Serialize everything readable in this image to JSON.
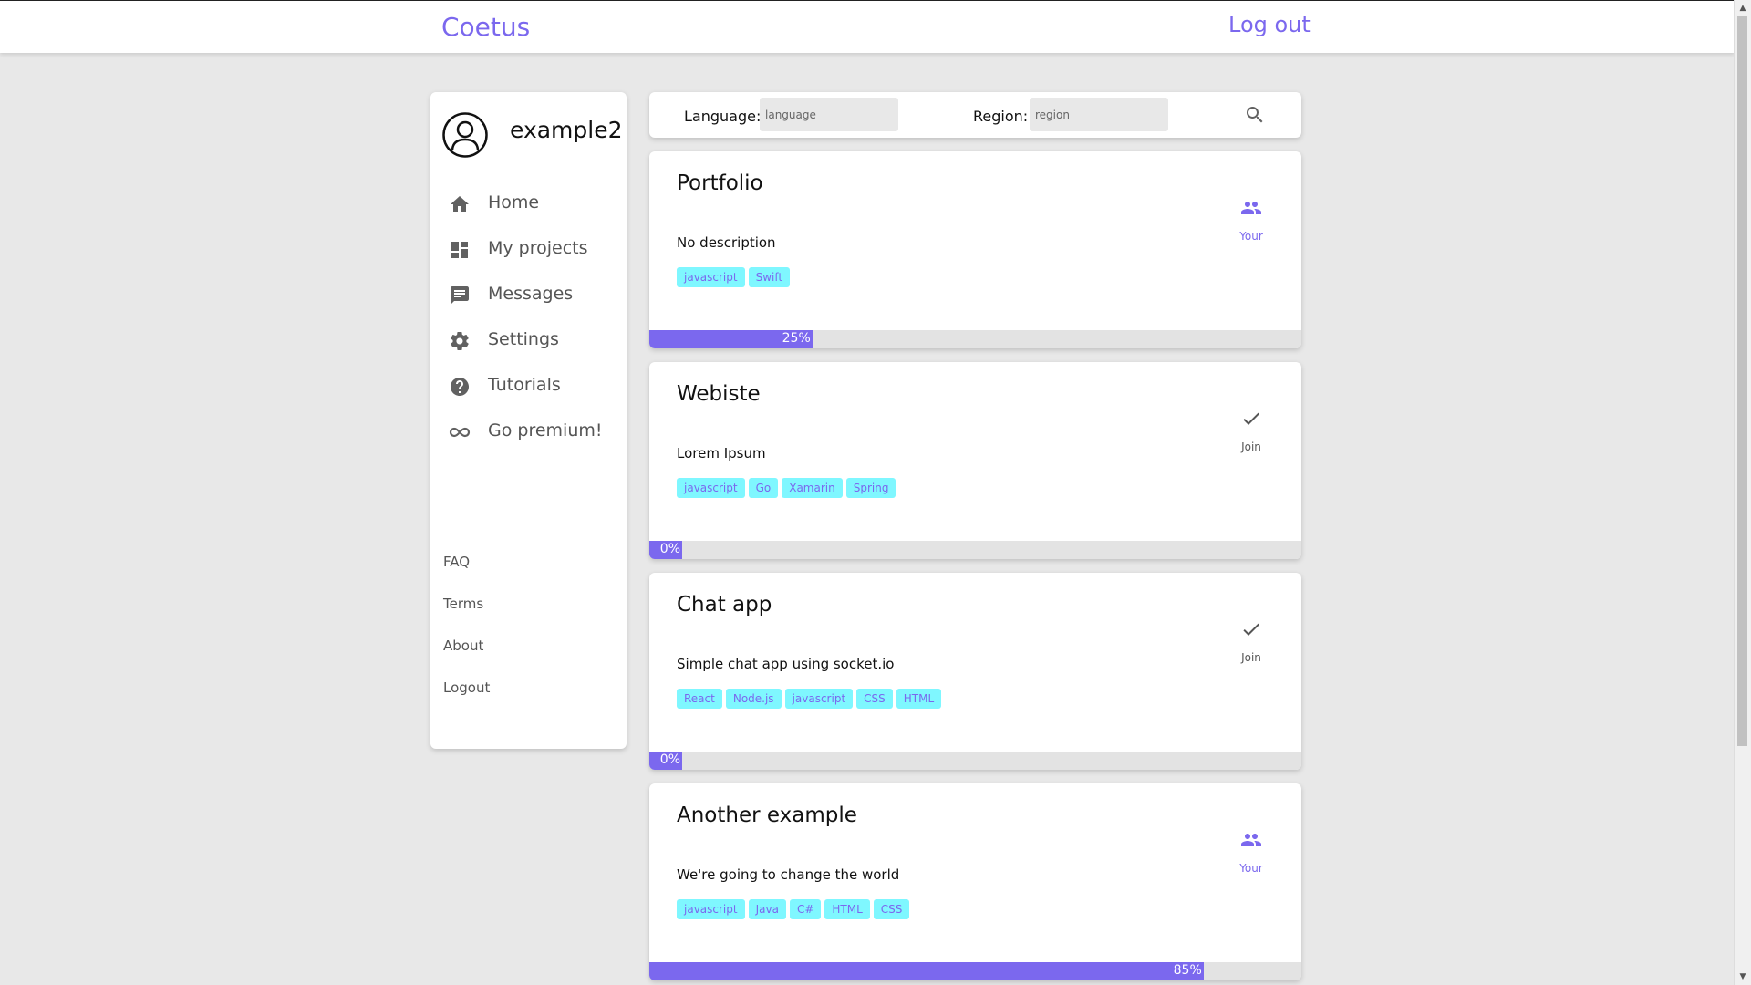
{
  "header": {
    "brand": "Coetus",
    "logout": "Log out"
  },
  "sidebar": {
    "username": "example2",
    "nav": [
      {
        "label": "Home",
        "icon": "home-icon"
      },
      {
        "label": "My projects",
        "icon": "dashboard-icon"
      },
      {
        "label": "Messages",
        "icon": "chat-icon"
      },
      {
        "label": "Settings",
        "icon": "gear-icon"
      },
      {
        "label": "Tutorials",
        "icon": "help-icon"
      },
      {
        "label": "Go premium!",
        "icon": "infinity-icon"
      }
    ],
    "footer": [
      "FAQ",
      "Terms",
      "About",
      "Logout"
    ]
  },
  "search": {
    "language_label": "Language:",
    "language_placeholder": "language",
    "region_label": "Region:",
    "region_placeholder": "region"
  },
  "colors": {
    "accent": "#7b68ee",
    "tag_bg": "#7ff7ff",
    "background": "#e8e8e8"
  },
  "projects": [
    {
      "title": "Portfolio",
      "description": "No description",
      "tags": [
        "javascript",
        "Swift"
      ],
      "action": "Your",
      "action_icon": "group-icon",
      "progress": 25,
      "progress_text": "25%"
    },
    {
      "title": "Webiste",
      "description": "Lorem Ipsum",
      "tags": [
        "javascript",
        "Go",
        "Xamarin",
        "Spring"
      ],
      "action": "Join",
      "action_icon": "check-icon",
      "progress": 0,
      "progress_text": "0%"
    },
    {
      "title": "Chat app",
      "description": "Simple chat app using socket.io",
      "tags": [
        "React",
        "Node.js",
        "javascript",
        "CSS",
        "HTML"
      ],
      "action": "Join",
      "action_icon": "check-icon",
      "progress": 0,
      "progress_text": "0%"
    },
    {
      "title": "Another example",
      "description": "We're going to change the world",
      "tags": [
        "javascript",
        "Java",
        "C#",
        "HTML",
        "CSS"
      ],
      "action": "Your",
      "action_icon": "group-icon",
      "progress": 85,
      "progress_text": "85%"
    }
  ]
}
